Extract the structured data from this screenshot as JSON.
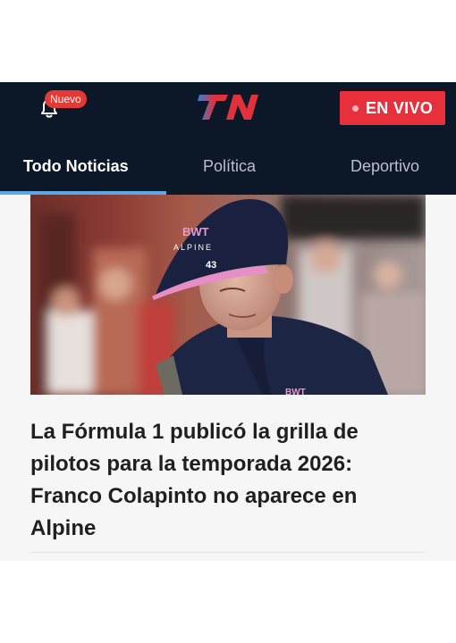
{
  "header": {
    "notification_badge": "Nuevo",
    "live_label": "EN VIVO",
    "brand_color": "#0c1728",
    "live_color": "#e7303b"
  },
  "tabs": [
    {
      "label": "Todo Noticias",
      "active": true
    },
    {
      "label": "Política",
      "active": false
    },
    {
      "label": "Deportivo",
      "active": false
    }
  ],
  "article": {
    "headline": "La Fórmula 1 publicó la grilla de pilotos para la temporada 2026: Franco Colapinto no aparece en Alpine",
    "image_cap_text": "BWT",
    "image_cap_brand": "ALPINE",
    "image_cap_number": "43",
    "image_shirt_text": "BWT"
  }
}
